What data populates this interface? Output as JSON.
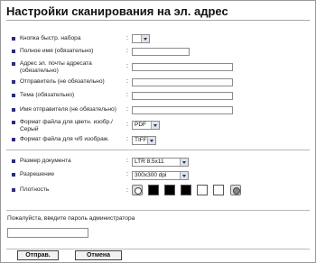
{
  "page": {
    "title": "Настройки сканирования на эл. адрес"
  },
  "fields": {
    "speed_dial": {
      "label": "Кнопка быстр. набора",
      "value": ""
    },
    "full_name": {
      "label": "Полное имя (обязательно)",
      "value": ""
    },
    "recipient_email": {
      "label": "Адрес эл. почты адресата (обязательно)",
      "value": ""
    },
    "sender": {
      "label": "Отправитель (не обязательно)",
      "value": ""
    },
    "subject": {
      "label": "Тема (обязательно)",
      "value": ""
    },
    "sender_name": {
      "label": "Имя отправителя (не обязательно)",
      "value": ""
    },
    "color_format": {
      "label": "Формат файла для цветн. изобр./Серый",
      "value": "PDF"
    },
    "bw_format": {
      "label": "Формат файла для ч/б изображ.",
      "value": "TIFF"
    },
    "doc_size": {
      "label": "Размер документа",
      "value": "LTR 8.5x11"
    },
    "resolution": {
      "label": "Разрешение",
      "value": "300x300 dpi"
    },
    "density": {
      "label": "Плотность",
      "level": 3,
      "levels": 5
    }
  },
  "colon": ":",
  "password": {
    "label": "Пожалуйста, введите пароль администратора",
    "value": ""
  },
  "buttons": {
    "send": "Отправ.",
    "cancel": "Отмена"
  },
  "colors": {
    "selected_density": "#000000",
    "unselected_density": "#ffffff",
    "accent": "#2c2c7a"
  }
}
